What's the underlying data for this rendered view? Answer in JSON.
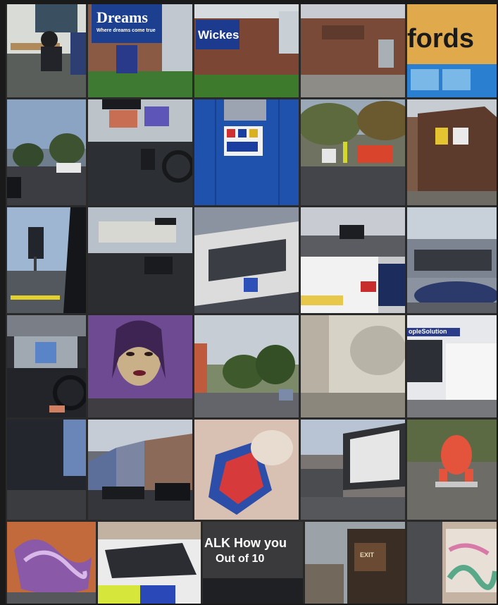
{
  "signs": {
    "dreams": "Dreams",
    "dreams_sub": "Where dreams come true",
    "wickes": "Wickes",
    "argos_partial": "fords",
    "people_solution": "opleSolution",
    "graffiti_line1": "ALK How you",
    "graffiti_line2": "Out of 10",
    "doorway": "EXIT"
  },
  "tiles": [
    {
      "name": "office-interior",
      "bg": "#6b6f6a"
    },
    {
      "name": "dreams-store",
      "bg": "#3d6a3a"
    },
    {
      "name": "wickes-store",
      "bg": "#b9c1c6"
    },
    {
      "name": "brick-warehouse",
      "bg": "#6a4434"
    },
    {
      "name": "fords-store",
      "bg": "#d8a54a"
    },
    {
      "name": "road-trees",
      "bg": "#6f7d8c"
    },
    {
      "name": "car-dashboard",
      "bg": "#383b40"
    },
    {
      "name": "blue-hoarding",
      "bg": "#1f4fa6"
    },
    {
      "name": "roadworks",
      "bg": "#6f7260"
    },
    {
      "name": "brick-building",
      "bg": "#7b5a48"
    },
    {
      "name": "street-sign-pole",
      "bg": "#8aa0c0"
    },
    {
      "name": "car-windscreen",
      "bg": "#3a3c3f"
    },
    {
      "name": "tilted-building",
      "bg": "#6a6e78"
    },
    {
      "name": "white-car",
      "bg": "#c8c9cd"
    },
    {
      "name": "parked-car-forecourt",
      "bg": "#8b93a0"
    },
    {
      "name": "car-interior-street",
      "bg": "#2e3036"
    },
    {
      "name": "portrait-mural",
      "bg": "#7b4f94"
    },
    {
      "name": "street-trees",
      "bg": "#7c8a6a"
    },
    {
      "name": "sunny-street",
      "bg": "#c9c4b8"
    },
    {
      "name": "shopfront-van",
      "bg": "#dadcdf"
    },
    {
      "name": "dark-building",
      "bg": "#2a2e34"
    },
    {
      "name": "terraced-houses",
      "bg": "#6a6d76"
    },
    {
      "name": "mural-closeup",
      "bg": "#c59a8c"
    },
    {
      "name": "billboard-street",
      "bg": "#7a7572"
    },
    {
      "name": "gorilla-statue",
      "bg": "#4a5a3c"
    },
    {
      "name": "graffiti-wall",
      "bg": "#6c4a7a"
    },
    {
      "name": "police-car",
      "bg": "#dcdcdc"
    },
    {
      "name": "graffiti-text",
      "bg": "#2a2a2a"
    },
    {
      "name": "doorway-sign",
      "bg": "#5a4a3a"
    },
    {
      "name": "painted-wall",
      "bg": "#b9a89a"
    }
  ]
}
